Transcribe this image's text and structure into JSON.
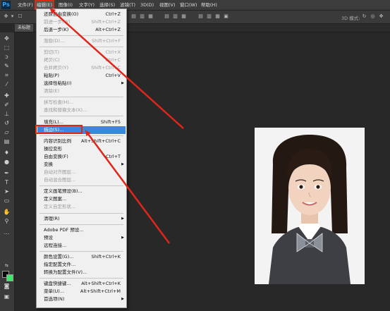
{
  "menubar": {
    "logo": "Ps",
    "items": [
      "文件(F)",
      "编辑(E)",
      "图像(I)",
      "文字(Y)",
      "选择(S)",
      "滤镜(T)",
      "3D(D)",
      "视图(V)",
      "窗口(W)",
      "帮助(H)"
    ],
    "active_index": 1
  },
  "optionsbar": {
    "mode_label": "3D 模式:"
  },
  "document": {
    "tab_label": "未标题"
  },
  "colors": {
    "foreground": "#0a0a0a",
    "background": "#3ee86a",
    "highlight": "#3a87e0",
    "annotation": "#e0261a"
  },
  "edit_menu": {
    "items": [
      {
        "label": "还原自由变换(O)",
        "shortcut": "Ctrl+Z"
      },
      {
        "label": "前进一步(W)",
        "shortcut": "Shift+Ctrl+Z",
        "disabled": true
      },
      {
        "label": "后退一步(K)",
        "shortcut": "Alt+Ctrl+Z"
      },
      {
        "label": "渐隐(D)...",
        "shortcut": "Shift+Ctrl+F",
        "disabled": true
      },
      {
        "label": "剪切(T)",
        "shortcut": "Ctrl+X",
        "disabled": true
      },
      {
        "label": "拷贝(C)",
        "shortcut": "Ctrl+C",
        "disabled": true
      },
      {
        "label": "合并拷贝(Y)",
        "shortcut": "Shift+Ctrl+C",
        "disabled": true
      },
      {
        "label": "粘贴(P)",
        "shortcut": "Ctrl+V"
      },
      {
        "label": "选择性粘贴(I)",
        "shortcut": "",
        "submenu": true
      },
      {
        "label": "清除(E)",
        "shortcut": "",
        "disabled": true
      },
      {
        "label": "拼写检查(H)...",
        "shortcut": "",
        "disabled": true
      },
      {
        "label": "查找和替换文本(X)...",
        "shortcut": "",
        "disabled": true
      },
      {
        "label": "填充(L)...",
        "shortcut": "Shift+F5"
      },
      {
        "label": "描边(S)...",
        "shortcut": "",
        "highlighted": true
      },
      {
        "label": "内容识别比例",
        "shortcut": "Alt+Shift+Ctrl+C"
      },
      {
        "label": "操控变形",
        "shortcut": ""
      },
      {
        "label": "自由变换(F)",
        "shortcut": "Ctrl+T"
      },
      {
        "label": "变换",
        "shortcut": "",
        "submenu": true
      },
      {
        "label": "自动对齐图层...",
        "shortcut": "",
        "disabled": true
      },
      {
        "label": "自动混合图层...",
        "shortcut": "",
        "disabled": true
      },
      {
        "label": "定义画笔预设(B)...",
        "shortcut": ""
      },
      {
        "label": "定义图案...",
        "shortcut": ""
      },
      {
        "label": "定义自定形状...",
        "shortcut": "",
        "disabled": true
      },
      {
        "label": "清理(R)",
        "shortcut": "",
        "submenu": true
      },
      {
        "label": "Adobe PDF 预设...",
        "shortcut": ""
      },
      {
        "label": "预设",
        "shortcut": "",
        "submenu": true
      },
      {
        "label": "远程连接...",
        "shortcut": ""
      },
      {
        "label": "颜色设置(G)...",
        "shortcut": "Shift+Ctrl+K"
      },
      {
        "label": "指定配置文件...",
        "shortcut": ""
      },
      {
        "label": "转换为配置文件(V)...",
        "shortcut": ""
      },
      {
        "label": "键盘快捷键...",
        "shortcut": "Alt+Shift+Ctrl+K"
      },
      {
        "label": "菜单(U)...",
        "shortcut": "Alt+Shift+Ctrl+M"
      },
      {
        "label": "首选项(N)",
        "shortcut": "",
        "submenu": true
      }
    ]
  },
  "tools": [
    "move-tool",
    "marquee-tool",
    "lasso-tool",
    "quick-select-tool",
    "crop-tool",
    "eyedropper-tool",
    "healing-tool",
    "brush-tool",
    "clone-stamp-tool",
    "history-brush-tool",
    "eraser-tool",
    "gradient-tool",
    "blur-tool",
    "dodge-tool",
    "pen-tool",
    "type-tool",
    "path-select-tool",
    "shape-tool",
    "hand-tool",
    "zoom-tool"
  ]
}
